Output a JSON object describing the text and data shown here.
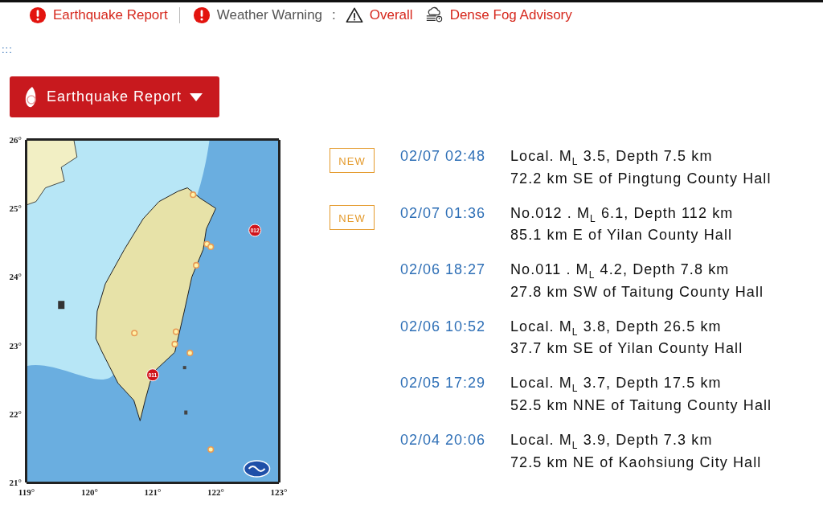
{
  "alert_bar": {
    "earthquake_link": "Earthquake Report",
    "weather_label": "Weather Warning",
    "separator": ":",
    "warnings": [
      {
        "kind": "overall",
        "label": "Overall"
      },
      {
        "kind": "fog",
        "label": "Dense Fog Advisory"
      }
    ]
  },
  "skip_link": ":::",
  "menu_button": {
    "label": "Earthquake Report",
    "expanded": false
  },
  "map": {
    "lat_labels": [
      "26°",
      "25°",
      "24°",
      "23°",
      "22°",
      "21°"
    ],
    "lon_labels": [
      "119°",
      "120°",
      "121°",
      "122°",
      "123°"
    ],
    "marker_labels": [
      "012",
      "011"
    ]
  },
  "reports": [
    {
      "badge": "NEW",
      "time": "02/07 02:48",
      "summary": "Local. M$_{L}$ 3.5, Depth 7.5 km",
      "location": "72.2 km SE of Pingtung County Hall"
    },
    {
      "badge": "NEW",
      "time": "02/07 01:36",
      "summary": "No.012 . M$_{L}$ 6.1, Depth 112 km",
      "location": "85.1 km E of Yilan County Hall"
    },
    {
      "time": "02/06 18:27",
      "summary": "No.011 . M$_{L}$ 4.2, Depth 7.8 km",
      "location": "27.8 km SW of Taitung County Hall"
    },
    {
      "time": "02/06 10:52",
      "summary": "Local. M$_{L}$ 3.8, Depth 26.5 km",
      "location": "37.7 km SE of Yilan County Hall"
    },
    {
      "time": "02/05 17:29",
      "summary": "Local. M$_{L}$ 3.7, Depth 17.5 km",
      "location": "52.5 km NNE of Taitung County Hall"
    },
    {
      "time": "02/04 20:06",
      "summary": "Local. M$_{L}$ 3.9, Depth 7.3 km",
      "location": "72.5 km NE of Kaohsiung City Hall"
    }
  ]
}
